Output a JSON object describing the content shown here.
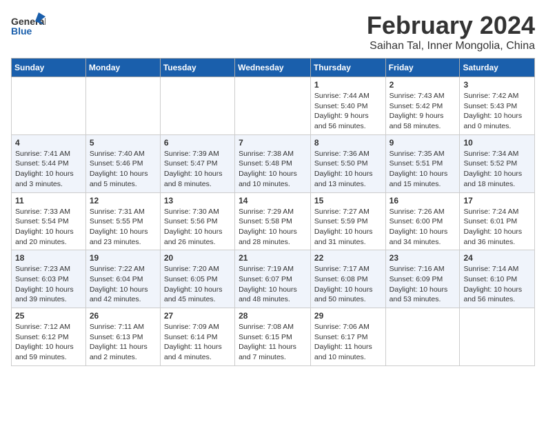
{
  "header": {
    "logo_general": "General",
    "logo_blue": "Blue",
    "month_title": "February 2024",
    "location": "Saihan Tal, Inner Mongolia, China"
  },
  "days_of_week": [
    "Sunday",
    "Monday",
    "Tuesday",
    "Wednesday",
    "Thursday",
    "Friday",
    "Saturday"
  ],
  "weeks": [
    [
      {
        "day": "",
        "content": ""
      },
      {
        "day": "",
        "content": ""
      },
      {
        "day": "",
        "content": ""
      },
      {
        "day": "",
        "content": ""
      },
      {
        "day": "1",
        "content": "Sunrise: 7:44 AM\nSunset: 5:40 PM\nDaylight: 9 hours and 56 minutes."
      },
      {
        "day": "2",
        "content": "Sunrise: 7:43 AM\nSunset: 5:42 PM\nDaylight: 9 hours and 58 minutes."
      },
      {
        "day": "3",
        "content": "Sunrise: 7:42 AM\nSunset: 5:43 PM\nDaylight: 10 hours and 0 minutes."
      }
    ],
    [
      {
        "day": "4",
        "content": "Sunrise: 7:41 AM\nSunset: 5:44 PM\nDaylight: 10 hours and 3 minutes."
      },
      {
        "day": "5",
        "content": "Sunrise: 7:40 AM\nSunset: 5:46 PM\nDaylight: 10 hours and 5 minutes."
      },
      {
        "day": "6",
        "content": "Sunrise: 7:39 AM\nSunset: 5:47 PM\nDaylight: 10 hours and 8 minutes."
      },
      {
        "day": "7",
        "content": "Sunrise: 7:38 AM\nSunset: 5:48 PM\nDaylight: 10 hours and 10 minutes."
      },
      {
        "day": "8",
        "content": "Sunrise: 7:36 AM\nSunset: 5:50 PM\nDaylight: 10 hours and 13 minutes."
      },
      {
        "day": "9",
        "content": "Sunrise: 7:35 AM\nSunset: 5:51 PM\nDaylight: 10 hours and 15 minutes."
      },
      {
        "day": "10",
        "content": "Sunrise: 7:34 AM\nSunset: 5:52 PM\nDaylight: 10 hours and 18 minutes."
      }
    ],
    [
      {
        "day": "11",
        "content": "Sunrise: 7:33 AM\nSunset: 5:54 PM\nDaylight: 10 hours and 20 minutes."
      },
      {
        "day": "12",
        "content": "Sunrise: 7:31 AM\nSunset: 5:55 PM\nDaylight: 10 hours and 23 minutes."
      },
      {
        "day": "13",
        "content": "Sunrise: 7:30 AM\nSunset: 5:56 PM\nDaylight: 10 hours and 26 minutes."
      },
      {
        "day": "14",
        "content": "Sunrise: 7:29 AM\nSunset: 5:58 PM\nDaylight: 10 hours and 28 minutes."
      },
      {
        "day": "15",
        "content": "Sunrise: 7:27 AM\nSunset: 5:59 PM\nDaylight: 10 hours and 31 minutes."
      },
      {
        "day": "16",
        "content": "Sunrise: 7:26 AM\nSunset: 6:00 PM\nDaylight: 10 hours and 34 minutes."
      },
      {
        "day": "17",
        "content": "Sunrise: 7:24 AM\nSunset: 6:01 PM\nDaylight: 10 hours and 36 minutes."
      }
    ],
    [
      {
        "day": "18",
        "content": "Sunrise: 7:23 AM\nSunset: 6:03 PM\nDaylight: 10 hours and 39 minutes."
      },
      {
        "day": "19",
        "content": "Sunrise: 7:22 AM\nSunset: 6:04 PM\nDaylight: 10 hours and 42 minutes."
      },
      {
        "day": "20",
        "content": "Sunrise: 7:20 AM\nSunset: 6:05 PM\nDaylight: 10 hours and 45 minutes."
      },
      {
        "day": "21",
        "content": "Sunrise: 7:19 AM\nSunset: 6:07 PM\nDaylight: 10 hours and 48 minutes."
      },
      {
        "day": "22",
        "content": "Sunrise: 7:17 AM\nSunset: 6:08 PM\nDaylight: 10 hours and 50 minutes."
      },
      {
        "day": "23",
        "content": "Sunrise: 7:16 AM\nSunset: 6:09 PM\nDaylight: 10 hours and 53 minutes."
      },
      {
        "day": "24",
        "content": "Sunrise: 7:14 AM\nSunset: 6:10 PM\nDaylight: 10 hours and 56 minutes."
      }
    ],
    [
      {
        "day": "25",
        "content": "Sunrise: 7:12 AM\nSunset: 6:12 PM\nDaylight: 10 hours and 59 minutes."
      },
      {
        "day": "26",
        "content": "Sunrise: 7:11 AM\nSunset: 6:13 PM\nDaylight: 11 hours and 2 minutes."
      },
      {
        "day": "27",
        "content": "Sunrise: 7:09 AM\nSunset: 6:14 PM\nDaylight: 11 hours and 4 minutes."
      },
      {
        "day": "28",
        "content": "Sunrise: 7:08 AM\nSunset: 6:15 PM\nDaylight: 11 hours and 7 minutes."
      },
      {
        "day": "29",
        "content": "Sunrise: 7:06 AM\nSunset: 6:17 PM\nDaylight: 11 hours and 10 minutes."
      },
      {
        "day": "",
        "content": ""
      },
      {
        "day": "",
        "content": ""
      }
    ]
  ]
}
